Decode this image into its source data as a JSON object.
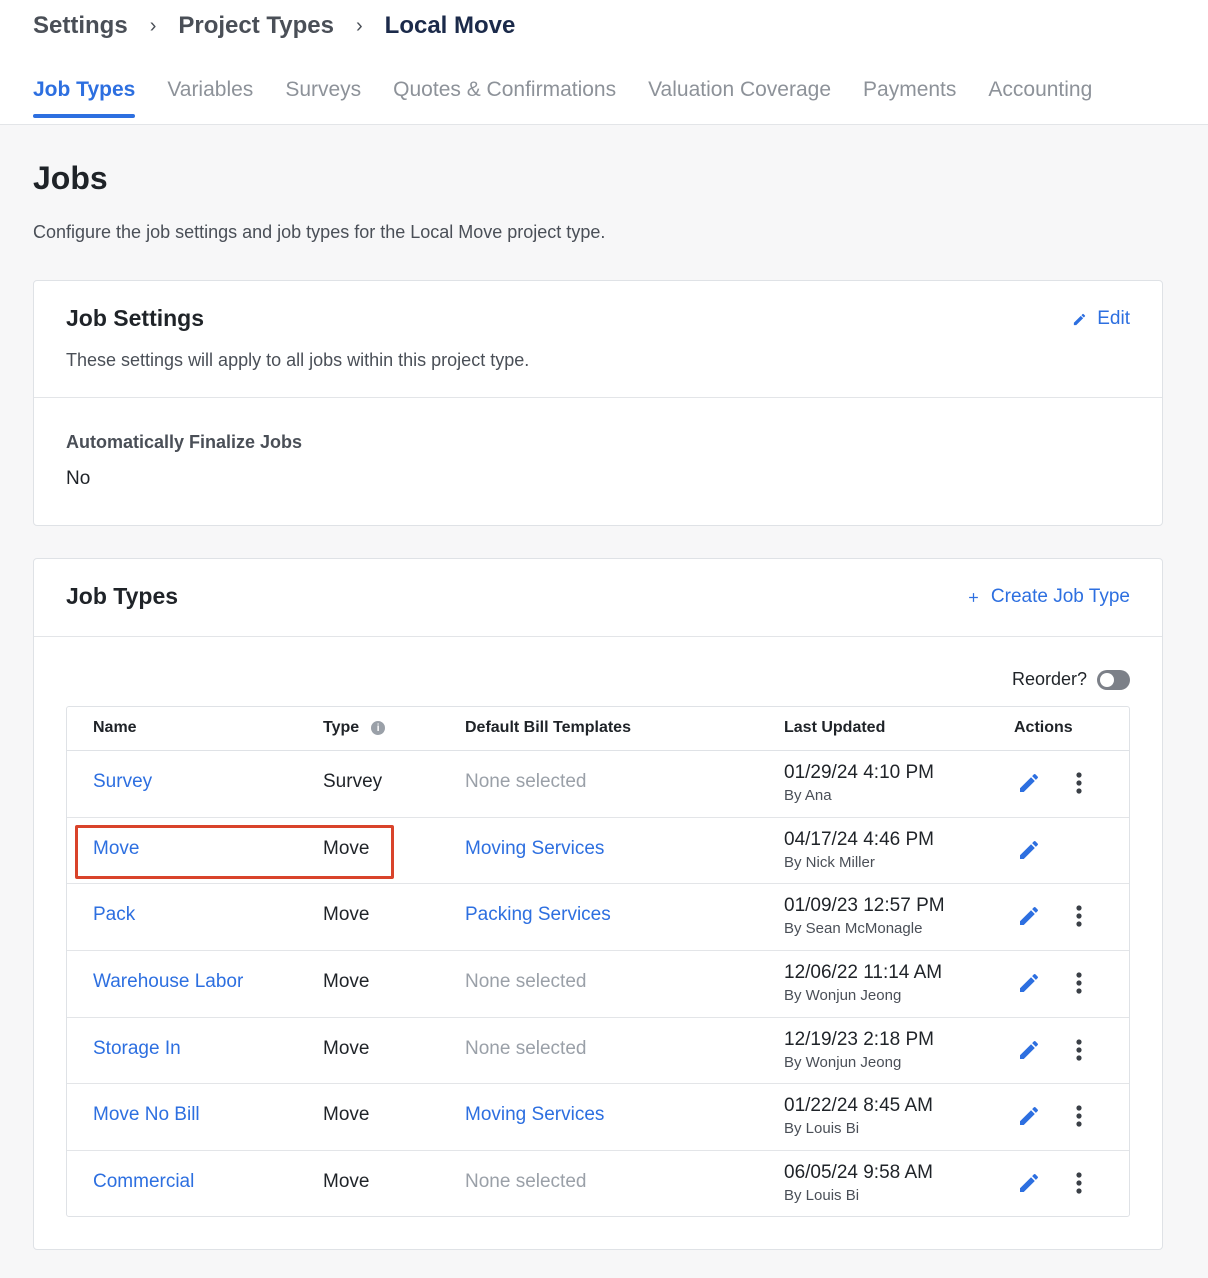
{
  "breadcrumb": {
    "items": [
      "Settings",
      "Project Types"
    ],
    "current": "Local Move"
  },
  "tabs": [
    "Job Types",
    "Variables",
    "Surveys",
    "Quotes & Confirmations",
    "Valuation Coverage",
    "Payments",
    "Accounting"
  ],
  "active_tab": "Job Types",
  "page": {
    "title": "Jobs",
    "description": "Configure the job settings and job types for the Local Move project type."
  },
  "job_settings": {
    "title": "Job Settings",
    "subtitle": "These settings will apply to all jobs within this project type.",
    "edit_label": "Edit",
    "field_label": "Automatically Finalize Jobs",
    "field_value": "No"
  },
  "job_types": {
    "title": "Job Types",
    "create_label": "Create Job Type",
    "reorder_label": "Reorder?",
    "reorder_on": false,
    "columns": [
      "Name",
      "Type",
      "Default Bill Templates",
      "Last Updated",
      "Actions"
    ],
    "rows": [
      {
        "name": "Survey",
        "type": "Survey",
        "template": "None selected",
        "template_selected": false,
        "updated": "01/29/24 4:10 PM",
        "by": "By Ana",
        "has_more": true
      },
      {
        "name": "Move",
        "type": "Move",
        "template": "Moving Services",
        "template_selected": true,
        "updated": "04/17/24 4:46 PM",
        "by": "By Nick Miller",
        "has_more": false
      },
      {
        "name": "Pack",
        "type": "Move",
        "template": "Packing Services",
        "template_selected": true,
        "updated": "01/09/23 12:57 PM",
        "by": "By Sean McMonagle",
        "has_more": true
      },
      {
        "name": "Warehouse Labor",
        "type": "Move",
        "template": "None selected",
        "template_selected": false,
        "updated": "12/06/22 11:14 AM",
        "by": "By Wonjun Jeong",
        "has_more": true
      },
      {
        "name": "Storage In",
        "type": "Move",
        "template": "None selected",
        "template_selected": false,
        "updated": "12/19/23 2:18 PM",
        "by": "By Wonjun Jeong",
        "has_more": true
      },
      {
        "name": "Move No Bill",
        "type": "Move",
        "template": "Moving Services",
        "template_selected": true,
        "updated": "01/22/24 8:45 AM",
        "by": "By Louis Bi",
        "has_more": true
      },
      {
        "name": "Commercial",
        "type": "Move",
        "template": "None selected",
        "template_selected": false,
        "updated": "06/05/24 9:58 AM",
        "by": "By Louis Bi",
        "has_more": true
      }
    ]
  },
  "colors": {
    "accent": "#2d6fe0",
    "highlight": "#d9432a"
  },
  "icons": [
    "chevron-right-icon",
    "pencil-icon",
    "plus-icon",
    "info-icon",
    "more-vertical-icon"
  ]
}
